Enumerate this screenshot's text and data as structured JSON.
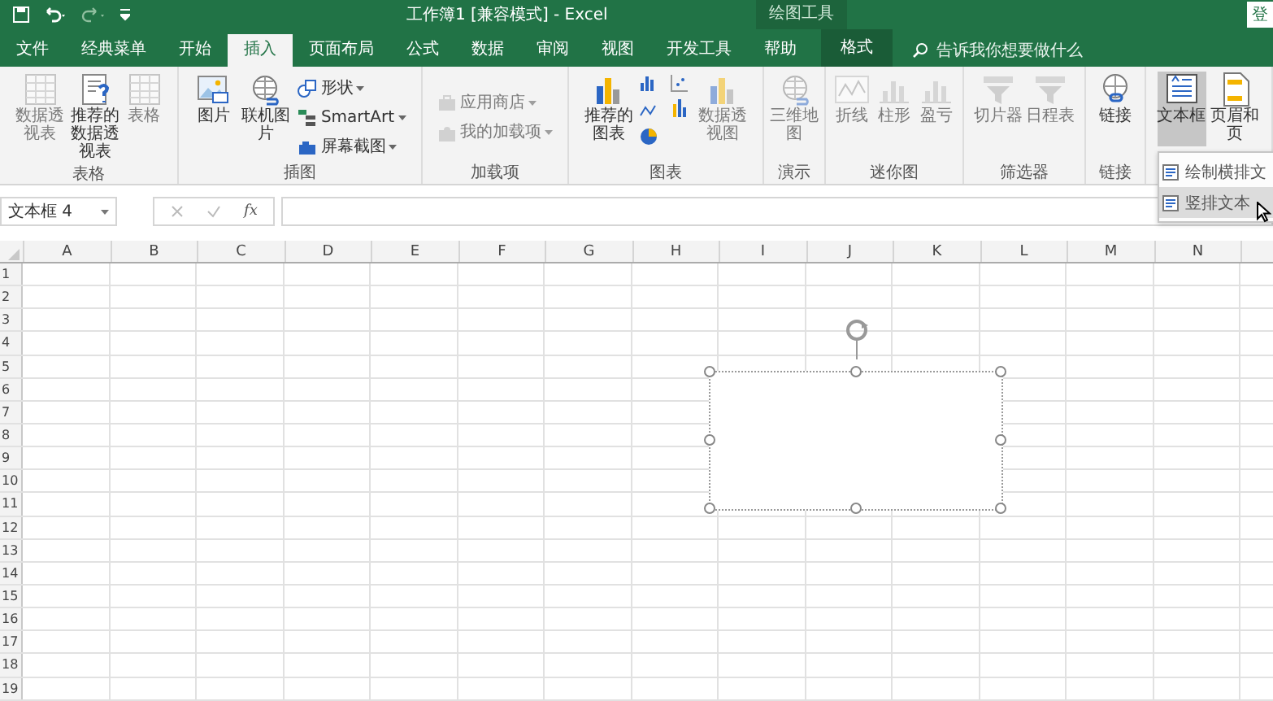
{
  "window": {
    "title": "工作簿1 [兼容模式] - Excel",
    "context_label": "绘图工具",
    "signin": "登"
  },
  "tabs": [
    {
      "label": "文件",
      "selected": false,
      "kind": "normal"
    },
    {
      "label": "经典菜单",
      "selected": false,
      "kind": "normal"
    },
    {
      "label": "开始",
      "selected": false,
      "kind": "normal"
    },
    {
      "label": "插入",
      "selected": true,
      "kind": "normal"
    },
    {
      "label": "页面布局",
      "selected": false,
      "kind": "normal"
    },
    {
      "label": "公式",
      "selected": false,
      "kind": "normal"
    },
    {
      "label": "数据",
      "selected": false,
      "kind": "normal"
    },
    {
      "label": "审阅",
      "selected": false,
      "kind": "normal"
    },
    {
      "label": "视图",
      "selected": false,
      "kind": "normal"
    },
    {
      "label": "开发工具",
      "selected": false,
      "kind": "normal"
    },
    {
      "label": "帮助",
      "selected": false,
      "kind": "normal"
    },
    {
      "label": "格式",
      "selected": false,
      "kind": "contextual"
    }
  ],
  "search": {
    "placeholder": "告诉我你想要做什么"
  },
  "ribbon_groups": [
    {
      "label": "表格",
      "items": [
        {
          "kind": "large",
          "label": "数据透视表",
          "disabled": true,
          "pressed": false
        },
        {
          "kind": "large",
          "label": "推荐的数据透视表",
          "disabled": false,
          "pressed": false
        },
        {
          "kind": "large",
          "label": "表格",
          "disabled": true,
          "pressed": false
        }
      ]
    },
    {
      "label": "插图",
      "items": [
        {
          "kind": "large",
          "label": "图片",
          "disabled": false,
          "pressed": false
        },
        {
          "kind": "large",
          "label": "联机图片",
          "disabled": false,
          "pressed": false
        },
        {
          "kind": "small",
          "label": "形状",
          "disabled": false,
          "pressed": false
        },
        {
          "kind": "small",
          "label": "SmartArt",
          "disabled": false,
          "pressed": false
        },
        {
          "kind": "small",
          "label": "屏幕截图",
          "disabled": false,
          "pressed": false
        }
      ]
    },
    {
      "label": "加载项",
      "items": [
        {
          "kind": "small",
          "label": "应用商店",
          "disabled": true,
          "pressed": false
        },
        {
          "kind": "small",
          "label": "我的加载项",
          "disabled": true,
          "pressed": false
        }
      ]
    },
    {
      "label": "图表",
      "items": [
        {
          "kind": "large",
          "label": "推荐的图表",
          "disabled": false,
          "pressed": false
        },
        {
          "kind": "icons",
          "disabled": false,
          "pressed": false
        },
        {
          "kind": "large",
          "label": "数据透视图",
          "disabled": true,
          "pressed": false
        }
      ]
    },
    {
      "label": "演示",
      "items": [
        {
          "kind": "large",
          "label": "三维地图",
          "disabled": true,
          "pressed": false
        }
      ]
    },
    {
      "label": "迷你图",
      "items": [
        {
          "kind": "large",
          "label": "折线",
          "disabled": true,
          "pressed": false
        },
        {
          "kind": "large",
          "label": "柱形",
          "disabled": true,
          "pressed": false
        },
        {
          "kind": "large",
          "label": "盈亏",
          "disabled": true,
          "pressed": false
        }
      ]
    },
    {
      "label": "筛选器",
      "items": [
        {
          "kind": "large",
          "label": "切片器",
          "disabled": true,
          "pressed": false
        },
        {
          "kind": "large",
          "label": "日程表",
          "disabled": true,
          "pressed": false
        }
      ]
    },
    {
      "label": "链接",
      "items": [
        {
          "kind": "large",
          "label": "链接",
          "disabled": false,
          "pressed": false
        }
      ]
    },
    {
      "items": [
        {
          "kind": "large",
          "label": "文本框",
          "disabled": false,
          "pressed": true
        },
        {
          "kind": "large",
          "label": "页眉和页",
          "disabled": false,
          "pressed": false
        }
      ]
    }
  ],
  "textbox_menu": [
    {
      "label": "绘制横排文",
      "selected": false
    },
    {
      "label": "竖排文本",
      "selected": true
    }
  ],
  "formula_bar": {
    "name_box": "文本框 4",
    "fx": "fx"
  },
  "sheet": {
    "columns": [
      "A",
      "B",
      "C",
      "D",
      "E",
      "F",
      "G",
      "H",
      "I",
      "J",
      "K",
      "L",
      "M",
      "N"
    ],
    "rows": [
      "1",
      "2",
      "3",
      "4",
      "5",
      "6",
      "7",
      "8",
      "9",
      "10",
      "11",
      "12",
      "13",
      "14",
      "15",
      "16",
      "17",
      "18",
      "19"
    ]
  }
}
